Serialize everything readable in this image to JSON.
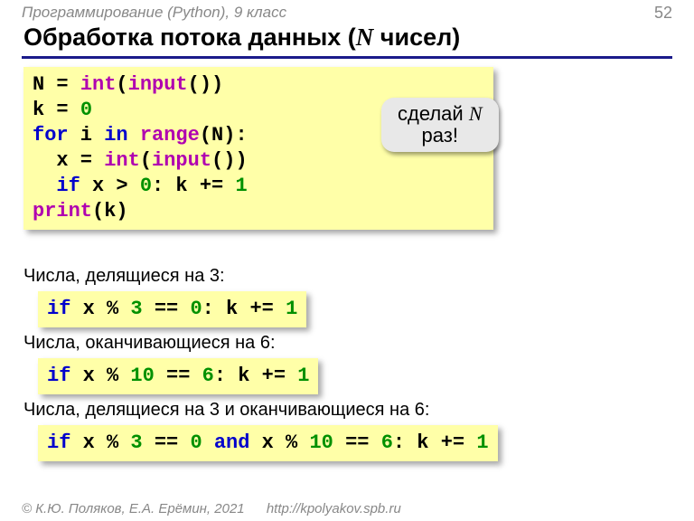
{
  "header": {
    "course": "Программирование (Python), 9 класс",
    "page": "52"
  },
  "title": {
    "prefix": "Обработка потока данных (",
    "var": "N",
    "suffix": " чисел)"
  },
  "maincode": {
    "l1a": "N = ",
    "l1b": "int",
    "l1c": "(",
    "l1d": "input",
    "l1e": "())",
    "l2a": "k = ",
    "l2b": "0",
    "l3a": "for",
    "l3b": " i ",
    "l3c": "in",
    "l3d": " ",
    "l3e": "range",
    "l3f": "(N):",
    "l4a": "  x = ",
    "l4b": "int",
    "l4c": "(",
    "l4d": "input",
    "l4e": "())",
    "l5a": "  if",
    "l5b": " x > ",
    "l5c": "0",
    "l5d": ": k += ",
    "l5e": "1",
    "l6": "print",
    "l6b": "(k)"
  },
  "callout": {
    "line1_a": "сделай ",
    "line1_b": "N",
    "line2": "раз!"
  },
  "labels": {
    "a": "Числа, делящиеся на 3:",
    "b": "Числа, оканчивающиеся на 6:",
    "c": "Числа, делящиеся на 3 и оканчивающиеся на 6:"
  },
  "snip": {
    "a_if": "if",
    "a_x": " x % ",
    "a_3": "3",
    "a_eq": " == ",
    "a_0": "0",
    "a_rest": ": k += ",
    "a_1": "1",
    "b_if": "if",
    "b_x": " x % ",
    "b_10": "10",
    "b_eq": " == ",
    "b_6": "6",
    "b_rest": ": k += ",
    "b_1": "1",
    "c_if": "if",
    "c_x1": " x % ",
    "c_3": "3",
    "c_eq1": " == ",
    "c_0": "0",
    "c_and": " and ",
    "c_x2": "x % ",
    "c_10": "10",
    "c_eq2": " == ",
    "c_6": "6",
    "c_rest": ": k += ",
    "c_1": "1"
  },
  "footer": {
    "copy": "© К.Ю. Поляков, Е.А. Ерёмин, 2021",
    "url": "http://kpolyakov.spb.ru"
  }
}
